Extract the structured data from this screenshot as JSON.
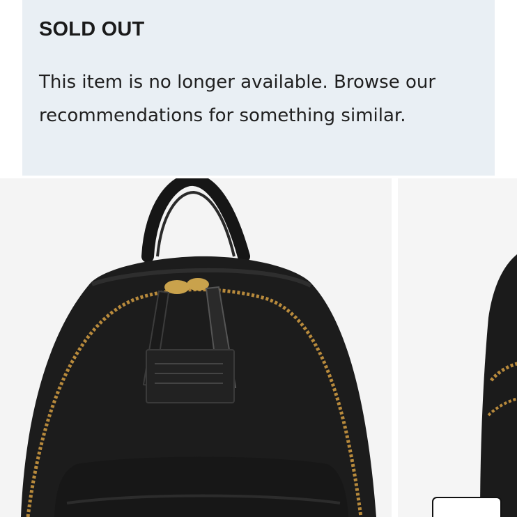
{
  "notice": {
    "title": "SOLD OUT",
    "message": "This item is no longer available. Browse our recommendations for something similar.",
    "background_color": "#e9eff4"
  },
  "recommendations": {
    "items": [
      {
        "image_icon": "backpack-image",
        "product_color": "#1c1c1c"
      },
      {
        "image_icon": "backpack-image",
        "product_color": "#1c1c1c"
      }
    ],
    "control_icon": "carousel-next-button"
  }
}
